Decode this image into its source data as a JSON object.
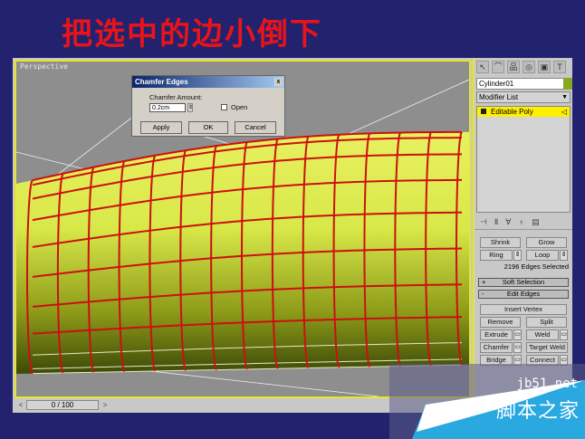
{
  "slide_title": "把选中的边小倒下",
  "viewport": {
    "label": "Perspective"
  },
  "timeline": {
    "value": "0 / 100",
    "prev": "<",
    "next": ">"
  },
  "dialog": {
    "title": "Chamfer Edges",
    "close": "x",
    "amount_label": "Chamfer Amount:",
    "amount_value": "0.2cm",
    "open_label": "Open",
    "open_checked": false,
    "apply": "Apply",
    "ok": "OK",
    "cancel": "Cancel"
  },
  "panel": {
    "object_name": "Cylinder01",
    "modifier_list": "Modifier List",
    "stack": [
      {
        "label": "Editable Poly"
      }
    ],
    "selection": {
      "shrink": "Shrink",
      "grow": "Grow",
      "ring": "Ring",
      "loop": "Loop",
      "status": "2196 Edges Selected"
    },
    "rollouts": {
      "soft": "Soft Selection",
      "soft_sign": "+",
      "edit": "Edit Edges",
      "edit_sign": "-"
    },
    "edit_edges": {
      "insert_vertex": "Insert Vertex",
      "remove": "Remove",
      "split": "Split",
      "extrude": "Extrude",
      "weld": "Weld",
      "chamfer": "Chamfer",
      "target_weld": "Target Weld",
      "bridge": "Bridge",
      "connect": "Connect"
    }
  },
  "watermark": {
    "site": "jb51.net",
    "name": "脚本之家"
  },
  "colors": {
    "background": "#22226e",
    "title": "#e8141a",
    "selection": "#e6e62a",
    "edges": "#cc1010",
    "mesh": "#c8d830"
  }
}
